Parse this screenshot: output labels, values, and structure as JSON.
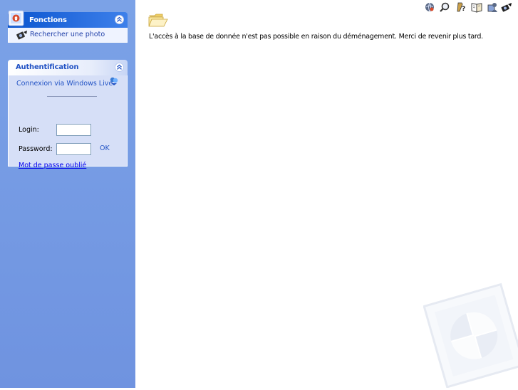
{
  "sidebar": {
    "fonctions": {
      "title": "Fonctions",
      "items": [
        {
          "label": "Rechercher une photo",
          "icon": "search-photo-icon"
        }
      ]
    },
    "auth": {
      "title": "Authentification",
      "windows_live_label": "Connexion via Windows Live",
      "login_label": "Login:",
      "login_value": "",
      "password_label": "Password:",
      "password_value": "",
      "ok_label": "OK",
      "forgot_label": "Mot de passe oublié"
    }
  },
  "main": {
    "message": "L'accès à la base de donnée n'est pas possible en raison du déménagement. Merci de revenir plus tard."
  },
  "toolbar": {
    "icons": [
      "globe-icon",
      "search-icon",
      "help-icon",
      "book-icon",
      "user-icon",
      "camera-search-icon"
    ]
  },
  "colors": {
    "sidebar_bg": "#7ba2e7",
    "fonctions_header": "#0a55cf",
    "auth_body": "#d6dff7",
    "link": "#2152c4"
  }
}
